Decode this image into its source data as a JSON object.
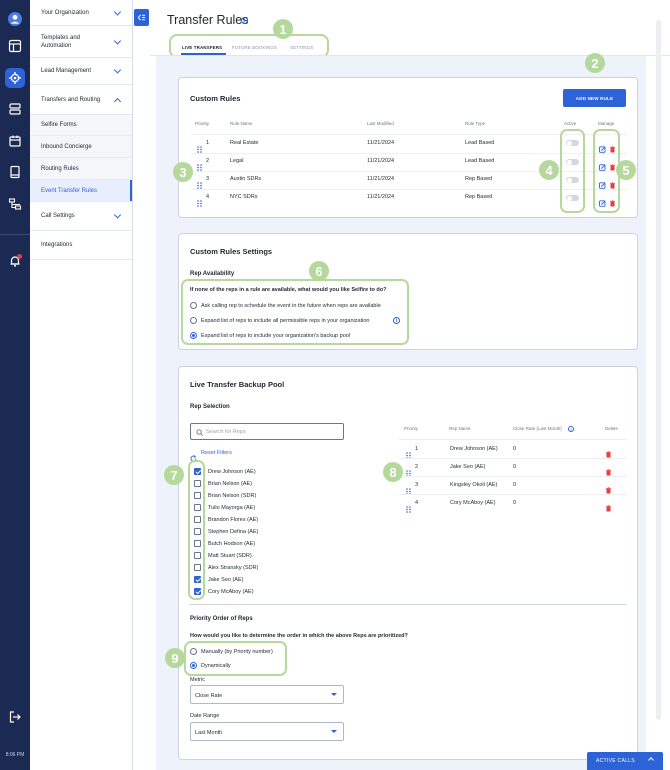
{
  "rail": {
    "time": "8:06 PM",
    "icons": [
      "avatar-icon",
      "layout-icon",
      "settings-icon",
      "server-icon",
      "calendar-icon",
      "book-icon",
      "routing-icon",
      "bell-icon",
      "logout-icon"
    ]
  },
  "nav": {
    "your_org": "Your Organization",
    "templates_line1": "Templates and",
    "templates_line2": "Automation",
    "lead_mgmt": "Lead Management",
    "transfers": "Transfers and Routing",
    "sub_items": [
      "Selfire Forms",
      "Inbound Concierge",
      "Routing Rules",
      "Event Transfer Rules"
    ],
    "call_settings": "Call Settings",
    "integrations": "Integrations"
  },
  "page": {
    "title": "Transfer Rules",
    "tabs": [
      "LIVE TRANSFERS",
      "FUTURE BOOKINGS",
      "SETTINGS"
    ]
  },
  "custom_rules": {
    "title": "Custom Rules",
    "add_button": "ADD NEW RULE",
    "headers": [
      "Priority",
      "Rule Name",
      "Last Modified",
      "Rule Type",
      "Active",
      "Manage"
    ],
    "rows": [
      {
        "priority": "1",
        "name": "Real Estate",
        "modified": "11/21/2024",
        "type": "Lead Based"
      },
      {
        "priority": "2",
        "name": "Legal",
        "modified": "11/21/2024",
        "type": "Lead Based"
      },
      {
        "priority": "3",
        "name": "Austin SDRs",
        "modified": "11/21/2024",
        "type": "Rep Based"
      },
      {
        "priority": "4",
        "name": "NYC SDRs",
        "modified": "11/21/2024",
        "type": "Rep Based"
      }
    ]
  },
  "rules_settings": {
    "title": "Custom Rules Settings",
    "rep_availability": "Rep Availability",
    "question": "If none of the reps in a rule are available, what would you like Selfire to do?",
    "options": [
      "Ask calling rep to schedule the event in the future when reps are available",
      "Expand list of reps to include all permissible reps in your organization",
      "Expand list of reps to include your organization's backup pool"
    ]
  },
  "backup_pool": {
    "title": "Live Transfer Backup Pool",
    "rep_selection": "Rep Selection",
    "search_placeholder": "Search for Reps",
    "reset": "Reset Filters",
    "reps": [
      {
        "name": "Drew Johnson (AE)",
        "checked": true
      },
      {
        "name": "Brian Nelson (AE)",
        "checked": false
      },
      {
        "name": "Brian Nelson (SDR)",
        "checked": false
      },
      {
        "name": "Tulio Mayorga (AE)",
        "checked": false
      },
      {
        "name": "Brandon Flores (AE)",
        "checked": false
      },
      {
        "name": "Stephen Defina (AE)",
        "checked": false
      },
      {
        "name": "Butch Hodson (AE)",
        "checked": false
      },
      {
        "name": "Matt Stuart (SDR)",
        "checked": false
      },
      {
        "name": "Alex Stransky (SDR)",
        "checked": false
      },
      {
        "name": "Jake Seo (AE)",
        "checked": true
      },
      {
        "name": "Cory McAboy (AE)",
        "checked": true
      }
    ],
    "headers": [
      "Priority",
      "Rep Name",
      "Close Rate (Last Month)",
      "Delete"
    ],
    "rows": [
      {
        "priority": "1",
        "name": "Drew Johnson (AE)",
        "rate": "0"
      },
      {
        "priority": "2",
        "name": "Jake Seo (AE)",
        "rate": "0"
      },
      {
        "priority": "3",
        "name": "Kingsley Okoli (AE)",
        "rate": "0"
      },
      {
        "priority": "4",
        "name": "Cory McAboy (AE)",
        "rate": "0"
      }
    ],
    "priority_title": "Priority Order of Reps",
    "priority_question": "How would you like to determine the order in which the above Reps are prioritized?",
    "priority_options": [
      "Manually (by Priority number)",
      "Dynamically"
    ],
    "metric_label": "Metric",
    "metric_value": "Close Rate",
    "range_label": "Date Range",
    "range_value": "Last Month"
  },
  "annotations": [
    "1",
    "2",
    "3",
    "4",
    "5",
    "6",
    "7",
    "8",
    "9"
  ],
  "active_calls": "ACTIVE CALLS",
  "colors": {
    "accent": "#2d63d6",
    "sidebar": "#1b2a52",
    "annotation": "#b5d99c",
    "danger": "#e53e3e"
  }
}
